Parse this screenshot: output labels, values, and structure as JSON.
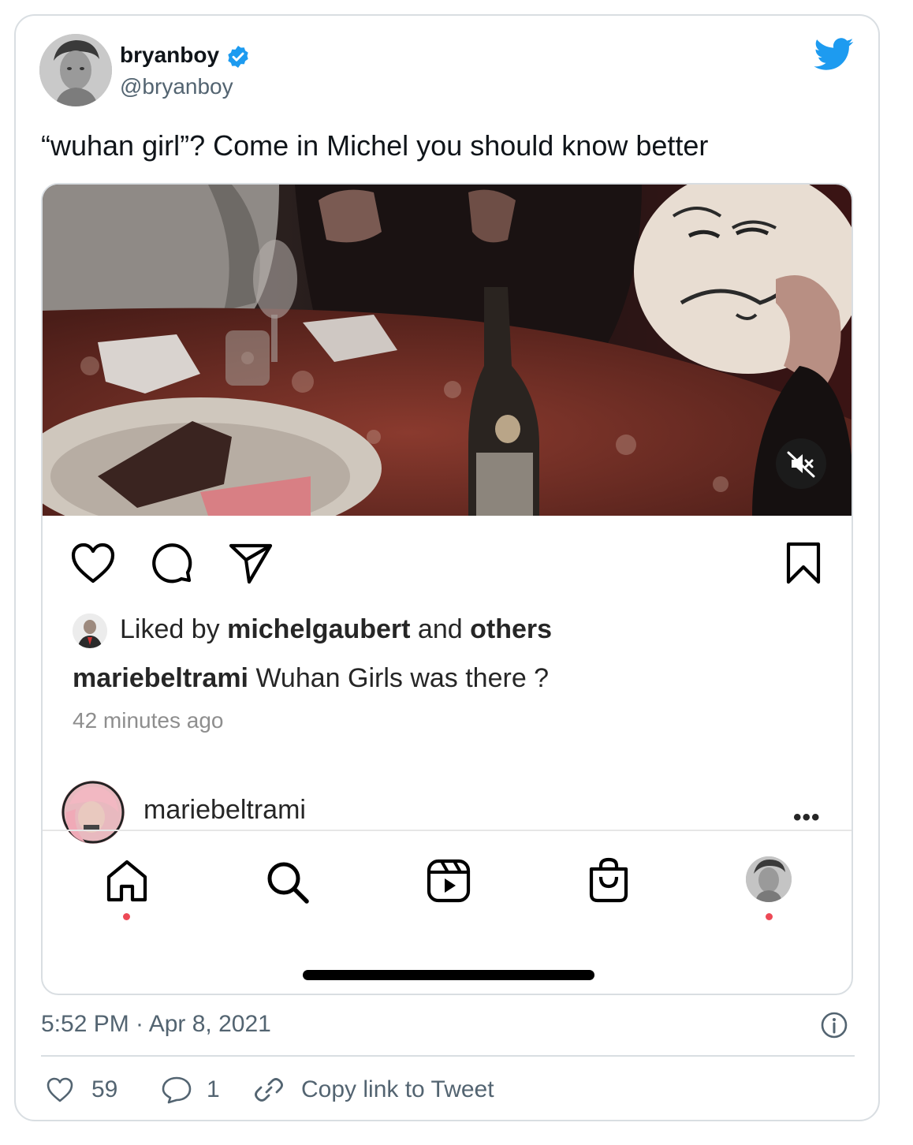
{
  "tweet": {
    "author_name": "bryanboy",
    "author_handle": "@bryanboy",
    "text": "“wuhan girl”? Come in Michel you should know better",
    "timestamp": "5:52 PM · Apr 8, 2021",
    "likes": "59",
    "replies": "1",
    "copy_link_label": "Copy link to Tweet",
    "brand_color": "#1d9bf0"
  },
  "instagram_post": {
    "liked_by_prefix": "Liked by ",
    "liked_by_user": "michelgaubert",
    "liked_by_and": " and ",
    "liked_by_others": "others",
    "caption_user": "mariebeltrami",
    "caption_text": " Wuhan Girls was there ?",
    "time_ago": "42 minutes ago",
    "profile_username": "mariebeltrami",
    "more_label": "•••",
    "notification_color": "#ed4956"
  },
  "icons": {
    "heart": "heart-icon",
    "comment": "comment-icon",
    "share": "share-icon",
    "bookmark": "bookmark-icon",
    "home": "home-icon",
    "search": "search-icon",
    "reels": "reels-icon",
    "shop": "shop-icon",
    "mute": "mute-icon",
    "info": "info-icon",
    "link": "link-icon",
    "verified": "verified-badge-icon",
    "twitter": "twitter-bird-icon"
  }
}
